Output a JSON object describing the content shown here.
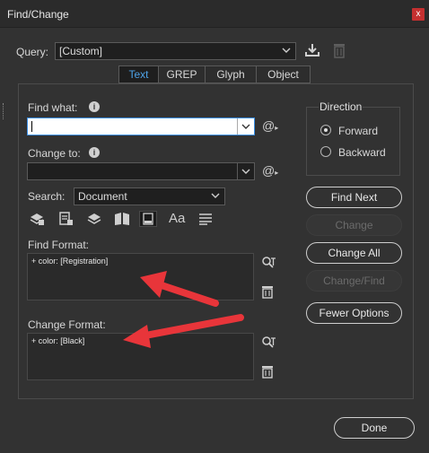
{
  "window": {
    "title": "Find/Change",
    "close_glyph": "x"
  },
  "query": {
    "label": "Query:",
    "value": "[Custom]"
  },
  "tabs": [
    {
      "label": "Text",
      "active": true
    },
    {
      "label": "GREP",
      "active": false
    },
    {
      "label": "Glyph",
      "active": false
    },
    {
      "label": "Object",
      "active": false
    }
  ],
  "find_what": {
    "label": "Find what:",
    "value": ""
  },
  "change_to": {
    "label": "Change to:",
    "value": ""
  },
  "search": {
    "label": "Search:",
    "value": "Document"
  },
  "find_format": {
    "label": "Find Format:",
    "value": "+ color: [Registration]"
  },
  "change_format": {
    "label": "Change Format:",
    "value": "+ color: [Black]"
  },
  "direction": {
    "label": "Direction",
    "options": [
      {
        "label": "Forward",
        "selected": true
      },
      {
        "label": "Backward",
        "selected": false
      }
    ]
  },
  "buttons": {
    "find_next": "Find Next",
    "change": "Change",
    "change_all": "Change All",
    "change_find": "Change/Find",
    "fewer_options": "Fewer Options",
    "done": "Done"
  },
  "toolbar_text_glyph": "Aa",
  "colors": {
    "accent": "#4ea3e8",
    "arrow": "#e8353a",
    "close": "#c53030"
  }
}
